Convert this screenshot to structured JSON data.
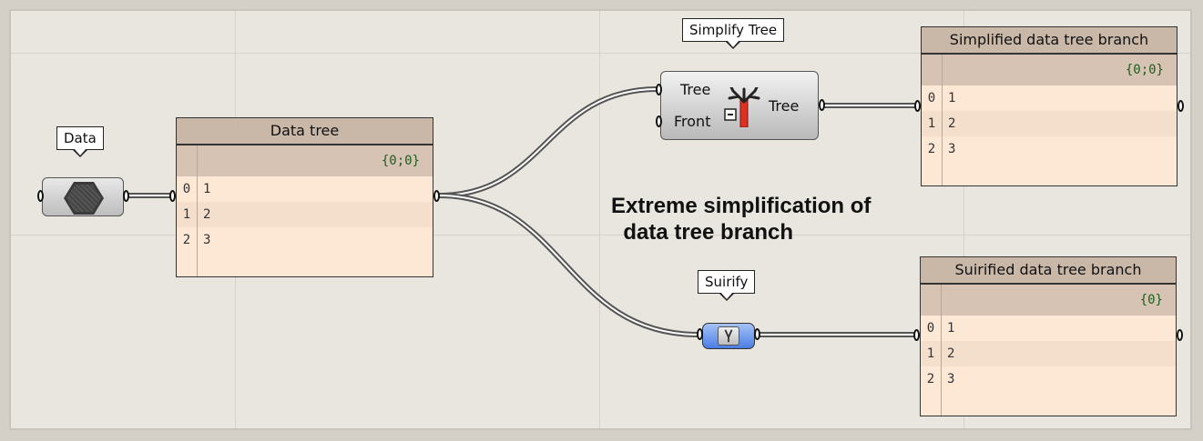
{
  "tags": {
    "data": "Data",
    "simplify": "Simplify Tree",
    "suirify": "Suirify"
  },
  "data_tree_panel": {
    "title": "Data tree",
    "path": "{0;0}",
    "rows": [
      {
        "index": "0",
        "value": "1"
      },
      {
        "index": "1",
        "value": "2"
      },
      {
        "index": "2",
        "value": "3"
      }
    ]
  },
  "simplify_component": {
    "input_tree": "Tree",
    "input_front": "Front",
    "output_tree": "Tree",
    "icon": "tree-icon"
  },
  "simplified_panel": {
    "title": "Simplified data tree branch",
    "path": "{0;0}",
    "rows": [
      {
        "index": "0",
        "value": "1"
      },
      {
        "index": "1",
        "value": "2"
      },
      {
        "index": "2",
        "value": "3"
      }
    ]
  },
  "suirified_panel": {
    "title": "Suirified data tree branch",
    "path": "{0}",
    "rows": [
      {
        "index": "0",
        "value": "1"
      },
      {
        "index": "1",
        "value": "2"
      },
      {
        "index": "2",
        "value": "3"
      }
    ]
  },
  "suirify_component": {
    "icon": "zip-icon"
  },
  "data_param": {
    "icon": "hexagon-icon"
  },
  "annotation": "Extreme simplification of\n  data tree branch",
  "colors": {
    "canvas": "#e9e6df",
    "panel_body": "#fde8d6",
    "panel_header": "#c9b8a8",
    "wire": "#555555",
    "suirify_blue": "#4a7de4",
    "path_text": "#1e5e1e"
  }
}
